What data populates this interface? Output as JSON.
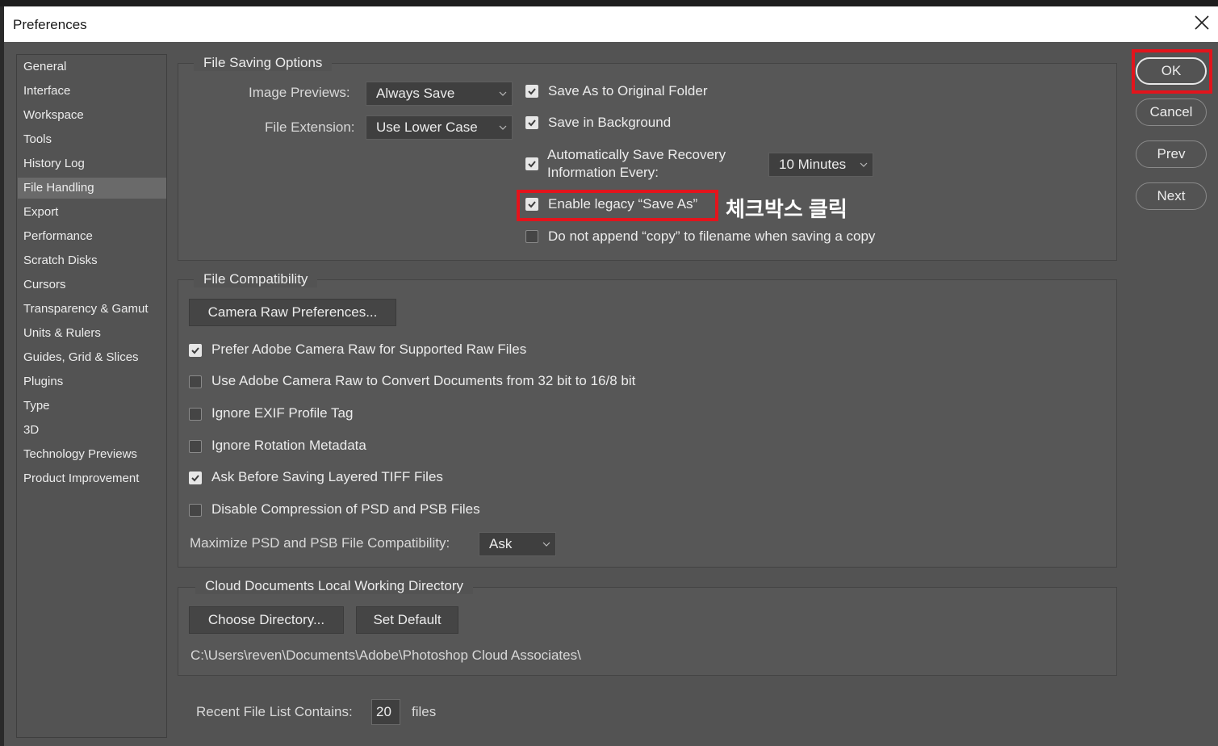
{
  "window": {
    "title": "Preferences"
  },
  "sidebar": {
    "items": [
      "General",
      "Interface",
      "Workspace",
      "Tools",
      "History Log",
      "File Handling",
      "Export",
      "Performance",
      "Scratch Disks",
      "Cursors",
      "Transparency & Gamut",
      "Units & Rulers",
      "Guides, Grid & Slices",
      "Plugins",
      "Type",
      "3D",
      "Technology Previews",
      "Product Improvement"
    ],
    "active": "File Handling"
  },
  "file_saving": {
    "title": "File Saving Options",
    "image_previews_label": "Image Previews:",
    "image_previews_value": "Always Save",
    "file_extension_label": "File Extension:",
    "file_extension_value": "Use Lower Case",
    "save_as_original": {
      "label": "Save As to Original Folder",
      "checked": true
    },
    "save_in_background": {
      "label": "Save in Background",
      "checked": true
    },
    "auto_recovery": {
      "label_line1": "Automatically Save Recovery",
      "label_line2": "Information Every:",
      "checked": true
    },
    "recovery_interval": "10 Minutes",
    "legacy_save_as": {
      "label": "Enable legacy “Save As”",
      "checked": true
    },
    "no_copy_append": {
      "label": "Do not append “copy” to filename when saving a copy",
      "checked": false
    }
  },
  "annotation": {
    "text": "체크박스 클릭"
  },
  "file_compat": {
    "title": "File Compatibility",
    "camera_raw_button": "Camera Raw Preferences...",
    "options": [
      {
        "label": "Prefer Adobe Camera Raw for Supported Raw Files",
        "checked": true
      },
      {
        "label": "Use Adobe Camera Raw to Convert Documents from 32 bit to 16/8 bit",
        "checked": false
      },
      {
        "label": "Ignore EXIF Profile Tag",
        "checked": false
      },
      {
        "label": "Ignore Rotation Metadata",
        "checked": false
      },
      {
        "label": "Ask Before Saving Layered TIFF Files",
        "checked": true
      },
      {
        "label": "Disable Compression of PSD and PSB Files",
        "checked": false
      }
    ],
    "maximize_label": "Maximize PSD and PSB File Compatibility:",
    "maximize_value": "Ask"
  },
  "cloud": {
    "title": "Cloud Documents Local Working Directory",
    "choose_button": "Choose Directory...",
    "default_button": "Set Default",
    "path": "C:\\Users\\reven\\Documents\\Adobe\\Photoshop Cloud Associates\\"
  },
  "recent": {
    "label": "Recent File List Contains:",
    "value": "20",
    "unit": "files"
  },
  "buttons": {
    "ok": "OK",
    "cancel": "Cancel",
    "prev": "Prev",
    "next": "Next"
  },
  "colors": {
    "highlight": "#e3141c",
    "background": "#535353"
  }
}
